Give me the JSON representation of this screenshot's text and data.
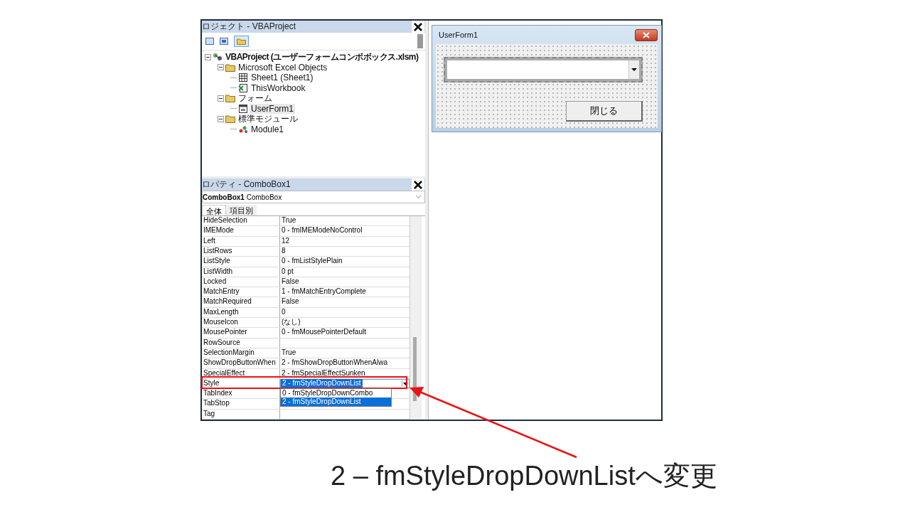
{
  "project_pane": {
    "title": "ロジェクト - VBAProject",
    "tree": [
      {
        "label": "VBAProject (ユーザーフォームコンボボックス.xlsm)",
        "kind": "project",
        "expanded": true,
        "selected": false,
        "children": [
          {
            "label": "Microsoft Excel Objects",
            "kind": "folder",
            "expanded": true,
            "selected": false,
            "children": [
              {
                "label": "Sheet1 (Sheet1)",
                "kind": "sheet",
                "selected": false
              },
              {
                "label": "ThisWorkbook",
                "kind": "workbook",
                "selected": false
              }
            ]
          },
          {
            "label": "フォーム",
            "kind": "folder",
            "expanded": true,
            "selected": false,
            "children": [
              {
                "label": "UserForm1",
                "kind": "form",
                "selected": true
              }
            ]
          },
          {
            "label": "標準モジュール",
            "kind": "folder",
            "expanded": true,
            "selected": false,
            "children": [
              {
                "label": "Module1",
                "kind": "module",
                "selected": false
              }
            ]
          }
        ]
      }
    ]
  },
  "properties_pane": {
    "title": "ロパティ - ComboBox1",
    "object_name": "ComboBox1",
    "object_type": "ComboBox",
    "tabs": [
      {
        "label": "全体",
        "selected": true
      },
      {
        "label": "項目別",
        "selected": false
      }
    ],
    "rows": [
      {
        "name": "HideSelection",
        "value": "True"
      },
      {
        "name": "IMEMode",
        "value": "0 - fmIMEModeNoControl"
      },
      {
        "name": "Left",
        "value": "12"
      },
      {
        "name": "ListRows",
        "value": "8"
      },
      {
        "name": "ListStyle",
        "value": "0 - fmListStylePlain"
      },
      {
        "name": "ListWidth",
        "value": "0 pt"
      },
      {
        "name": "Locked",
        "value": "False"
      },
      {
        "name": "MatchEntry",
        "value": "1 - fmMatchEntryComplete"
      },
      {
        "name": "MatchRequired",
        "value": "False"
      },
      {
        "name": "MaxLength",
        "value": "0"
      },
      {
        "name": "MouseIcon",
        "value": "(なし)"
      },
      {
        "name": "MousePointer",
        "value": "0 - fmMousePointerDefault"
      },
      {
        "name": "RowSource"
      },
      {
        "name": "SelectionMargin",
        "value": "True"
      },
      {
        "name": "ShowDropButtonWhen",
        "value": "2 - fmShowDropButtonWhenAlwa"
      },
      {
        "name": "SpecialEffect",
        "value": "2 - fmSpecialEffectSunken"
      },
      {
        "name": "Style",
        "value": "2 - fmStyleDropDownList",
        "kind": "combo",
        "options": [
          {
            "label": "0 - fmStyleDropDownCombo",
            "selected": false
          },
          {
            "label": "2 - fmStyleDropDownList",
            "selected": true
          }
        ]
      },
      {
        "name": "TabIndex"
      },
      {
        "name": "TabStop"
      },
      {
        "name": "Tag"
      }
    ]
  },
  "user_form": {
    "title": "UserForm1",
    "button": "閉じる"
  },
  "caption": "2 – fmStyleDropDownListへ変更"
}
